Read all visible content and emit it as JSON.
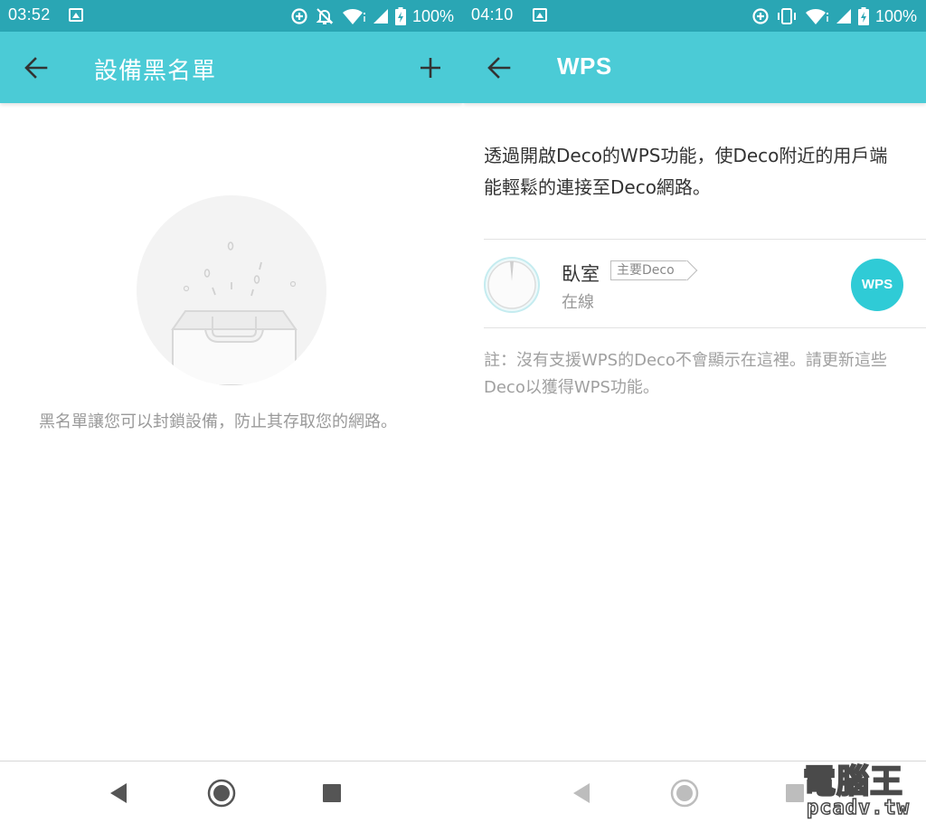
{
  "left_screen": {
    "status_bar": {
      "time": "03:52",
      "battery": "100%"
    },
    "app_bar": {
      "title": "設備黑名單"
    },
    "empty_state": {
      "description": "黑名單讓您可以封鎖設備，防止其存取您的網路。"
    }
  },
  "right_screen": {
    "status_bar": {
      "time": "04:10",
      "battery": "100%"
    },
    "app_bar": {
      "title": "WPS"
    },
    "intro": "透過開啟Deco的WPS功能，使Deco附近的用戶端能輕鬆的連接至Deco網路。",
    "device": {
      "name": "臥室",
      "tag": "主要Deco",
      "status": "在線",
      "wps_button_label": "WPS"
    },
    "note": "註：沒有支援WPS的Deco不會顯示在這裡。請更新這些Deco以獲得WPS功能。"
  },
  "watermark": {
    "line1": "電腦王",
    "line2": "pcadv.tw"
  },
  "colors": {
    "status_bar": "#2aa6b4",
    "app_bar": "#4bcbd6",
    "wps_button": "#2fcbd6"
  },
  "icons": {
    "status_left": [
      "gallery-icon"
    ],
    "status_right_left_screen": [
      "data-saver-icon",
      "bell-off-icon",
      "wifi-icon",
      "cell-signal-icon",
      "battery-charging-icon"
    ],
    "status_right_right_screen": [
      "data-saver-icon",
      "vibrate-icon",
      "wifi-icon",
      "cell-signal-icon",
      "battery-charging-icon"
    ]
  }
}
